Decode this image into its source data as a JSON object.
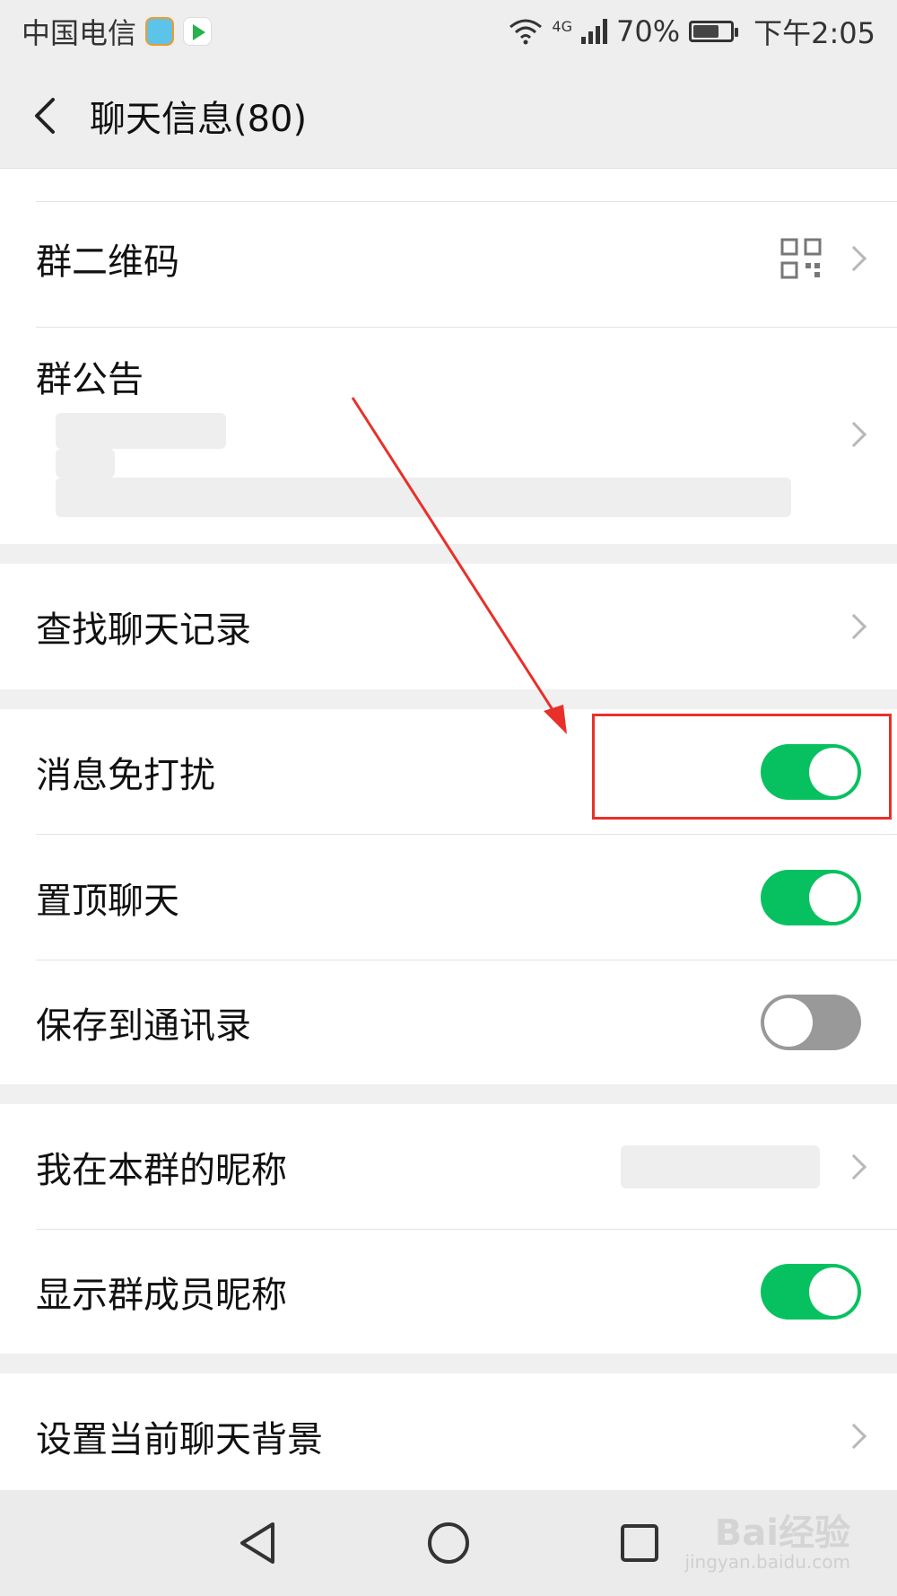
{
  "status_bar": {
    "carrier": "中国电信",
    "network": "4G",
    "battery_percent": "70%",
    "battery_level": 0.7,
    "time": "下午2:05"
  },
  "header": {
    "title": "聊天信息(80)"
  },
  "settings": {
    "group_qr": {
      "label": "群二维码"
    },
    "announcement": {
      "label": "群公告"
    },
    "search_history": {
      "label": "查找聊天记录"
    },
    "mute": {
      "label": "消息免打扰",
      "enabled": true
    },
    "pin": {
      "label": "置顶聊天",
      "enabled": true
    },
    "save_contacts": {
      "label": "保存到通讯录",
      "enabled": false
    },
    "my_nickname": {
      "label": "我在本群的昵称"
    },
    "show_nicknames": {
      "label": "显示群成员昵称",
      "enabled": true
    },
    "chat_background": {
      "label": "设置当前聊天背景"
    }
  },
  "watermark": {
    "brand": "Bai经验",
    "url": "jingyan.baidu.com"
  },
  "colors": {
    "toggle_on": "#07c160",
    "toggle_off": "#999999",
    "annotation": "#e8302a"
  },
  "icons": {
    "qr": "qr-code-icon",
    "back": "chevron-left-icon",
    "chevron": "chevron-right-icon"
  }
}
